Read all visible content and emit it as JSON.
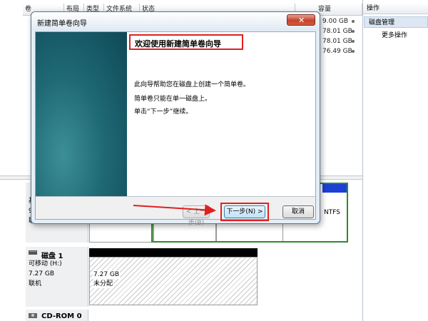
{
  "console": {
    "columns": [
      "卷",
      "布局",
      "类型",
      "文件系统",
      "状态",
      "容量"
    ],
    "capacities": [
      "9.00 GB",
      "78.01 GB",
      "78.01 GB",
      "76.49 GB"
    ],
    "actions_title": "操作",
    "actions_disk": "磁盘管理",
    "actions_more": "更多操作",
    "disk0_fragments": [
      "基",
      "9",
      "联"
    ],
    "ntfs_text": "NTFS",
    "ntfs_status": "",
    "disk1": {
      "name": "磁盘 1",
      "type": "可移动 (H:)",
      "size": "7.27 GB",
      "status": "联机",
      "part_size": "7.27 GB",
      "part_status": "未分配"
    },
    "cdrom": "CD-ROM 0"
  },
  "wizard": {
    "title": "新建简单卷向导",
    "close": "✕",
    "heading": "欢迎使用新建简单卷向导",
    "paragraphs": [
      "此向导帮助您在磁盘上创建一个简单卷。",
      "简单卷只能在单一磁盘上。",
      "单击“下一步”继续。"
    ],
    "back_label": "< 上一步(B)",
    "next_label": "下一步(N) >",
    "cancel_label": "取消"
  },
  "colors": {
    "highlight": "#e02020",
    "banner": "#1f6975",
    "ntfs_green": "#2e8b2e",
    "disk_bar": "#000000",
    "partition_blue": "#1c3fd6"
  }
}
